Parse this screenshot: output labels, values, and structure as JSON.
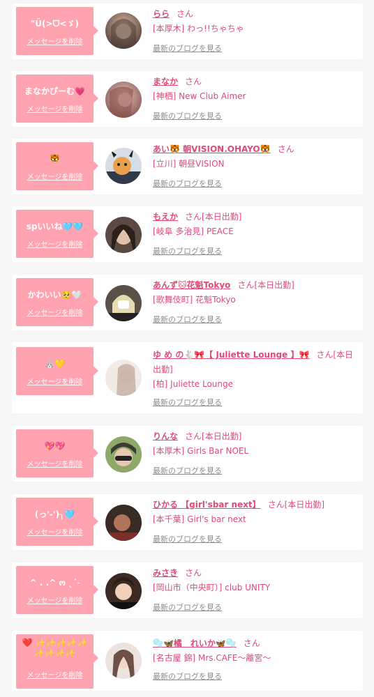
{
  "colors": {
    "bubble": "#ffa3b1",
    "accent": "#e04a74",
    "muted": "#8c8c8c",
    "background": "#f6f6f6"
  },
  "items": [
    {
      "message": "\"Ü(>ᗜ<ゞ)",
      "delete_label": "メッセージを削除",
      "name": "らら",
      "suffix": "さん",
      "shop": "[本厚木] わっ!!ちゃちゃ",
      "blog_label": "最新のブログを見る",
      "avatar_colors": [
        "#b08f7a",
        "#4a3a33"
      ]
    },
    {
      "message": "まなかぴーむ💗",
      "delete_label": "メッセージを削除",
      "name": "まなか",
      "suffix": "さん",
      "shop": "[神栖] New Club Aimer",
      "blog_label": "最新のブログを見る",
      "avatar_colors": [
        "#c98a86",
        "#7c4d4b"
      ]
    },
    {
      "message": "🐯",
      "delete_label": "メッセージを削除",
      "name": "あい🐯 朝VISION.OHAYO🐯",
      "suffix": "さん",
      "shop": "[立川] 朝昼VISION",
      "blog_label": "最新のブログを見る",
      "avatar_colors": [
        "#e7a04c",
        "#2f3a4a"
      ]
    },
    {
      "message": "spいいね🩵🩵",
      "delete_label": "メッセージを削除",
      "name": "もえか",
      "suffix": "さん[本日出勤]",
      "shop": "[岐阜 多治見] PEACE",
      "blog_label": "最新のブログを見る",
      "avatar_colors": [
        "#c9a08a",
        "#2a211d"
      ]
    },
    {
      "message": "かわいい🥺🤍",
      "delete_label": "メッセージを削除",
      "name": "あんず🐱花魁Tokyo",
      "suffix": "さん[本日出勤]",
      "shop": "[歌舞伎町] 花魁Tokyo",
      "blog_label": "最新のブログを見る",
      "avatar_colors": [
        "#e6dcb0",
        "#5a5048"
      ]
    },
    {
      "message": "🐰💛",
      "delete_label": "メッセージを削除",
      "name": "ゆ め の🐇🎀【 Juliette Lounge 】🎀",
      "suffix": "さん[本日出勤]",
      "shop": "[柏] Juliette Lounge",
      "blog_label": "最新のブログを見る",
      "avatar_colors": [
        "#e9d6d0",
        "#bfa59a"
      ]
    },
    {
      "message": "💖💖",
      "delete_label": "メッセージを削除",
      "name": "りんな",
      "suffix": "さん[本日出勤]",
      "shop": "[本厚木] Girls Bar NOEL",
      "blog_label": "最新のブログを見る",
      "avatar_colors": [
        "#8da96a",
        "#3c3a33"
      ]
    },
    {
      "message": "(っ'-')╮🩵",
      "delete_label": "メッセージを削除",
      "name": "ひかる 【girl'sbar next】",
      "suffix": "さん[本日出勤]",
      "shop": "[本千葉] Girl's bar next",
      "blog_label": "最新のブログを見る",
      "avatar_colors": [
        "#c58266",
        "#3a2a24"
      ]
    },
    {
      "message": "^ . .^ ო ˎˊ˗",
      "delete_label": "メッセージを削除",
      "name": "みさき",
      "suffix": "さん",
      "shop": "[岡山市（中央町）] club UNITY",
      "blog_label": "最新のブログを見る",
      "avatar_colors": [
        "#e0b99b",
        "#3b2a22"
      ]
    },
    {
      "message": "❤️ ✨✨✨✨✨ ✨✨✨✨",
      "delete_label": "メッセージを削除",
      "name": "🫧🦋橘　れいか🦋🫧",
      "suffix": "さん",
      "shop": "[名古屋 錦] Mrs.CAFE〜離宮〜",
      "blog_label": "最新のブログを見る",
      "avatar_colors": [
        "#e4d5cf",
        "#6e5048"
      ]
    }
  ]
}
